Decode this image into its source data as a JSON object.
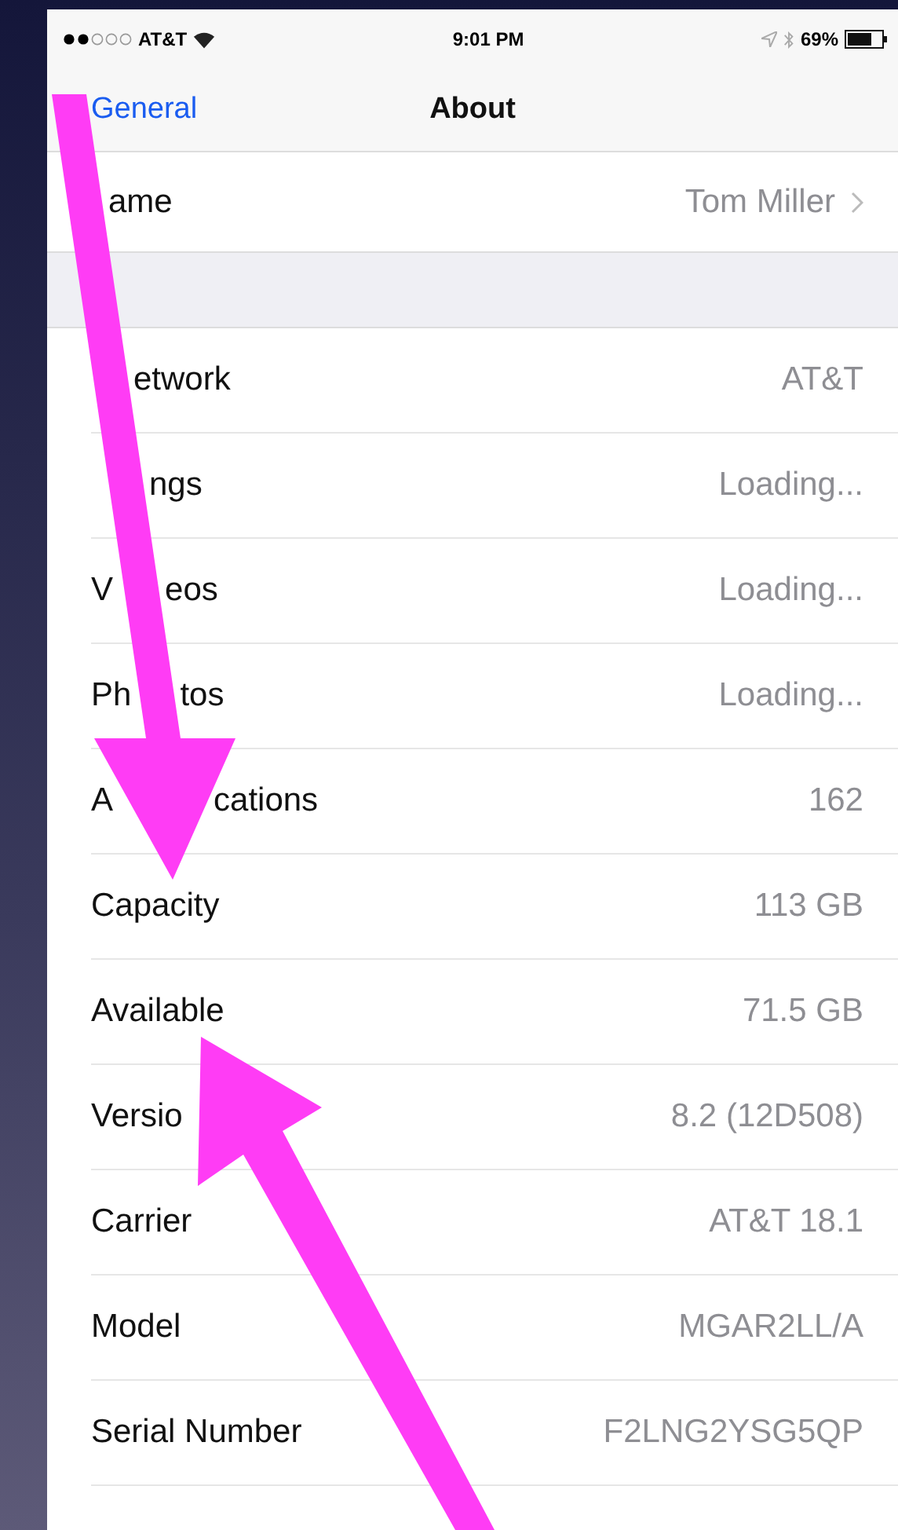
{
  "status_bar": {
    "carrier": "AT&T",
    "time": "9:01 PM",
    "battery": "69%"
  },
  "nav_bar": {
    "back": "General",
    "title": "About"
  },
  "name_row": {
    "label_parts": [
      "ame"
    ],
    "value": "Tom Miller"
  },
  "rows": [
    {
      "label_parts": [
        "etwork"
      ],
      "value": "AT&T"
    },
    {
      "label_parts": [
        "ngs"
      ],
      "value": "Loading..."
    },
    {
      "label_parts": [
        "V",
        "eos"
      ],
      "value": "Loading..."
    },
    {
      "label_parts": [
        "Ph",
        "tos"
      ],
      "value": "Loading..."
    },
    {
      "label_parts": [
        "A",
        "cations"
      ],
      "value": "162"
    },
    {
      "label_parts": [
        "Capacity"
      ],
      "value": "113 GB"
    },
    {
      "label_parts": [
        "Available"
      ],
      "value": "71.5 GB"
    },
    {
      "label_parts": [
        "Versio"
      ],
      "value": "8.2 (12D508)"
    },
    {
      "label_parts": [
        "Carrier"
      ],
      "value": "AT&T 18.1"
    },
    {
      "label_parts": [
        "Model"
      ],
      "value": "MGAR2LL/A"
    },
    {
      "label_parts": [
        "Serial Number"
      ],
      "value": "F2LNG2YSG5QP"
    }
  ]
}
